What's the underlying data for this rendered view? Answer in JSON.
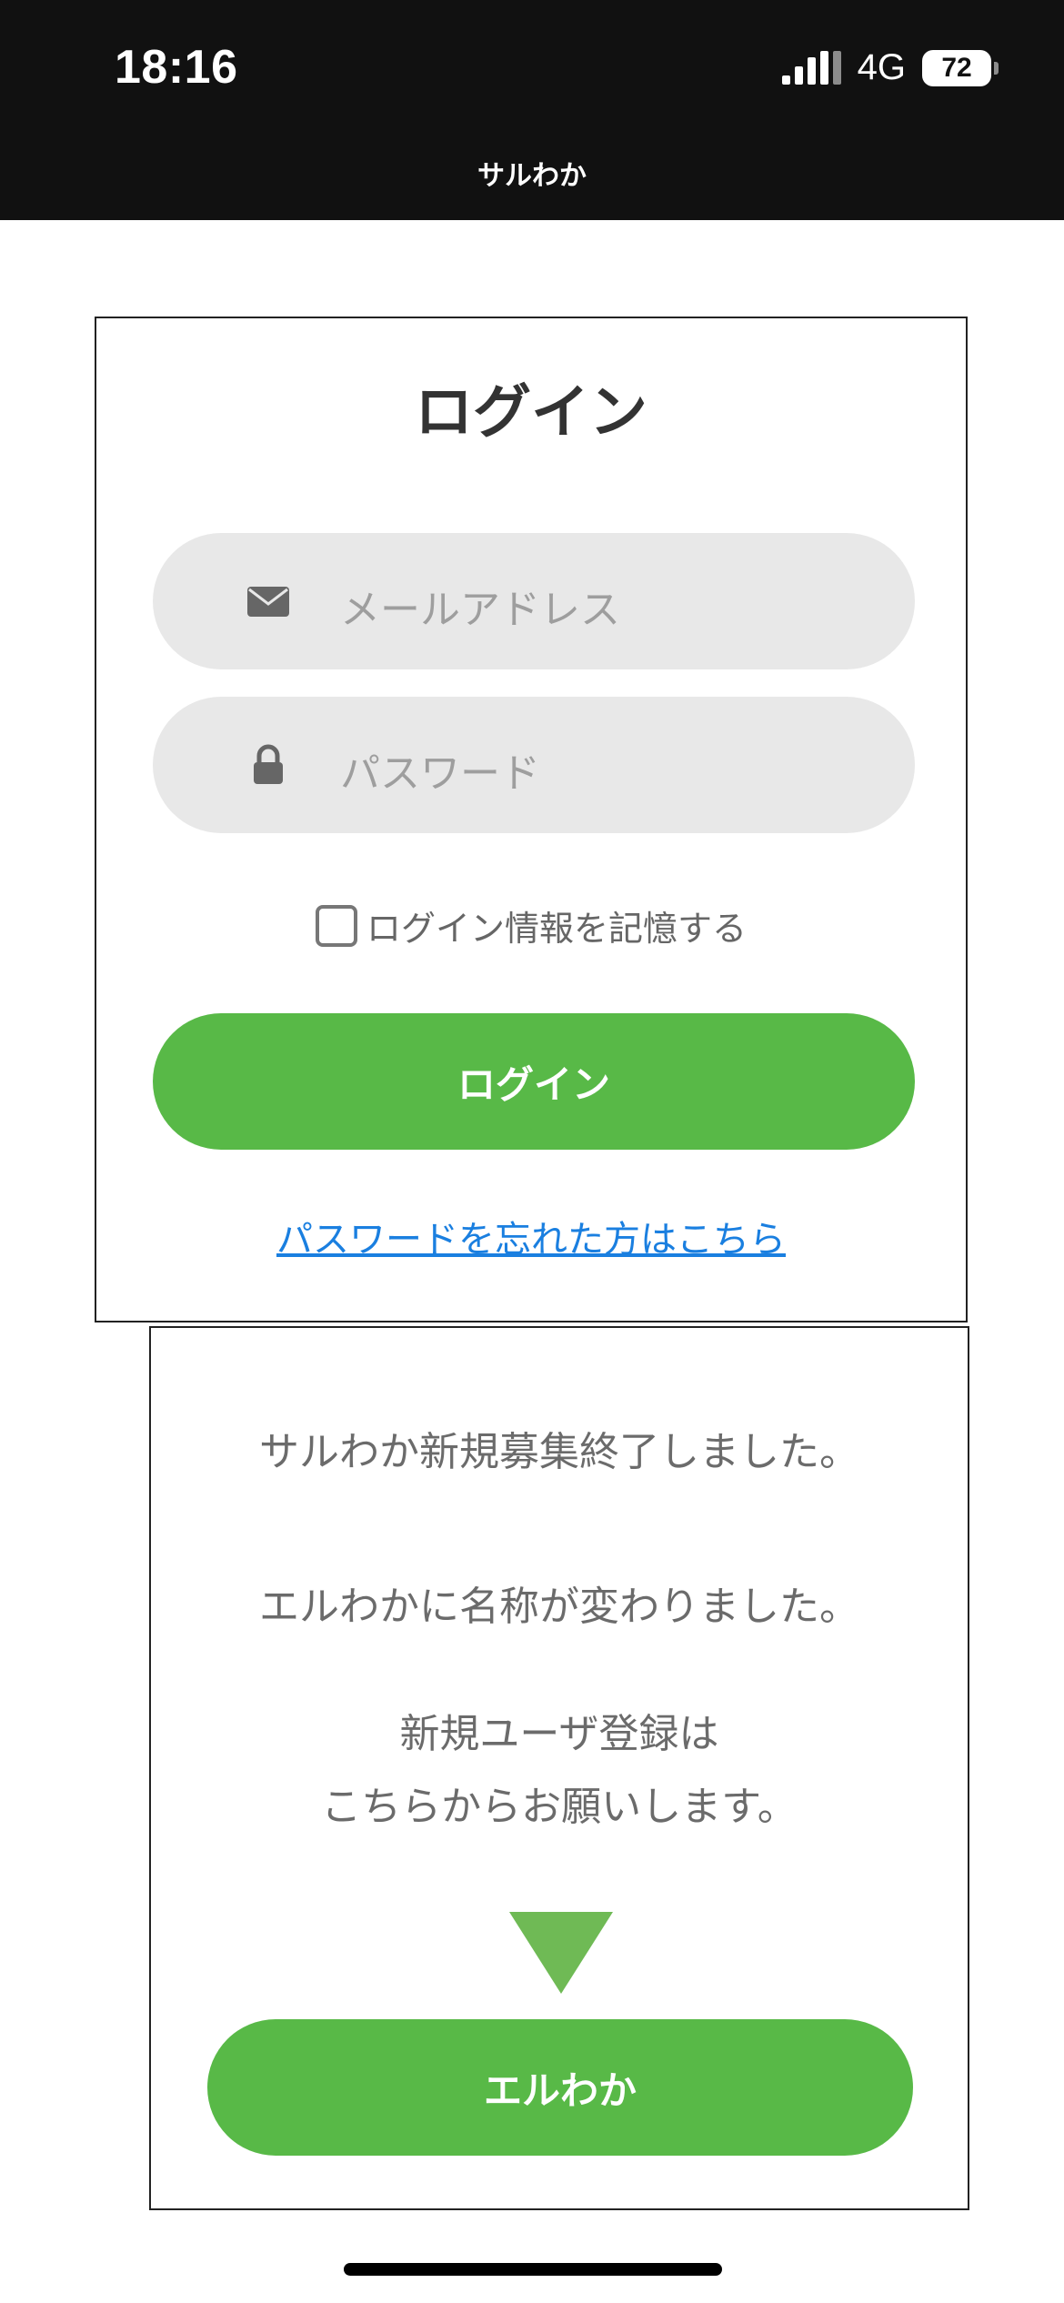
{
  "status_bar": {
    "time": "18:16",
    "network": "4G",
    "battery": "72"
  },
  "header": {
    "app_title": "サルわか"
  },
  "login": {
    "heading": "ログイン",
    "email_placeholder": "メールアドレス",
    "password_placeholder": "パスワード",
    "remember_label": "ログイン情報を記憶する",
    "remember_checked": false,
    "login_button": "ログイン",
    "forgot_link": "パスワードを忘れた方はこちら"
  },
  "notice": {
    "line1": "サルわか新規募集終了しました。",
    "line2": "エルわかに名称が変わりました。",
    "line3": "新規ユーザ登録は",
    "line4": "こちらからお願いします。",
    "button": "エルわか"
  },
  "icons": {
    "email": "envelope-icon",
    "password": "lock-icon",
    "arrow": "triangle-down-icon"
  },
  "colors": {
    "accent_green": "#58b947",
    "link_blue": "#1a7fe0",
    "field_bg": "#e8e8e8",
    "topbar_bg": "#111111"
  }
}
